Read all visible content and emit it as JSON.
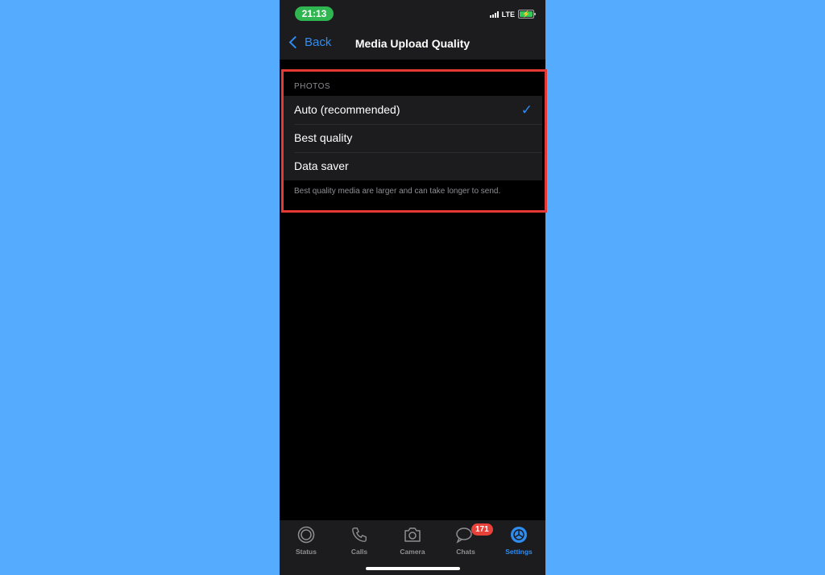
{
  "status_bar": {
    "time": "21:13",
    "network": "LTE"
  },
  "nav": {
    "back_label": "Back",
    "title": "Media Upload Quality"
  },
  "section": {
    "header": "PHOTOS",
    "options": [
      {
        "label": "Auto (recommended)",
        "selected": true
      },
      {
        "label": "Best quality",
        "selected": false
      },
      {
        "label": "Data saver",
        "selected": false
      }
    ],
    "footnote": "Best quality media are larger and can take longer to send."
  },
  "tabs": [
    {
      "label": "Status",
      "icon": "status-icon"
    },
    {
      "label": "Calls",
      "icon": "phone-icon"
    },
    {
      "label": "Camera",
      "icon": "camera-icon"
    },
    {
      "label": "Chats",
      "icon": "chat-icon",
      "badge": "171"
    },
    {
      "label": "Settings",
      "icon": "gear-icon",
      "active": true
    }
  ],
  "colors": {
    "accent": "#2f8cf0",
    "highlight_border": "#e53935",
    "background": "#55acff"
  }
}
